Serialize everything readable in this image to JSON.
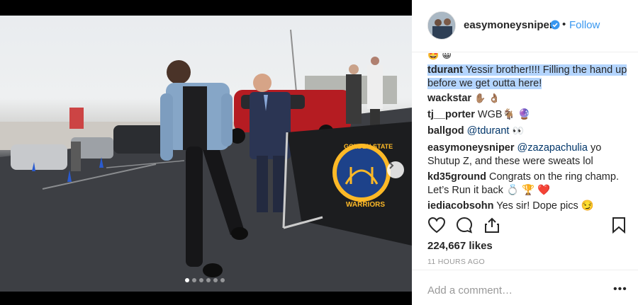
{
  "post": {
    "image_alt": "photo",
    "carousel_total": 6,
    "carousel_index": 1
  },
  "header": {
    "username": "easymoneysniper",
    "verified_icon": "verified-badge-icon",
    "separator": "•",
    "follow_label": "Follow"
  },
  "comments": [
    {
      "author": "",
      "text": "🤩 😀",
      "partial": true
    },
    {
      "author": "tdurant",
      "text": "Yessir brother!!!! Filling the hand up before we get outta here!",
      "highlighted": true
    },
    {
      "author": "wackstar",
      "text": "✋🏽 👌🏽"
    },
    {
      "author": "tj__porter",
      "text": "WGB🐐 🔮"
    },
    {
      "author": "ballgod",
      "mention": "@tdurant",
      "text": "👀"
    },
    {
      "author": "easymoneysniper",
      "mention": "@zazapachulia",
      "text": "yo Shutup Z, and these were sweats lol"
    },
    {
      "author": "kd35ground",
      "text": "Congrats on the ring champ. Let’s Run it back 💍 🏆 ❤️"
    },
    {
      "author": "iediacobsohn",
      "text": "Yes sir! Dope pics 😏"
    }
  ],
  "actions": {
    "like_icon": "heart-icon",
    "comment_icon": "comment-bubble-icon",
    "share_icon": "share-icon",
    "save_icon": "bookmark-icon"
  },
  "likes_text": "224,667 likes",
  "time_text": "11 HOURS AGO",
  "add_comment": {
    "placeholder": "Add a comment…",
    "more_label": "•••"
  },
  "logo_text": [
    "GOLDEN STATE",
    "WARRIORS"
  ],
  "colors": {
    "link_blue": "#3897f0",
    "highlight": "#b4d5fe",
    "warriors_gold": "#fdb927",
    "warriors_blue": "#1d428a"
  }
}
